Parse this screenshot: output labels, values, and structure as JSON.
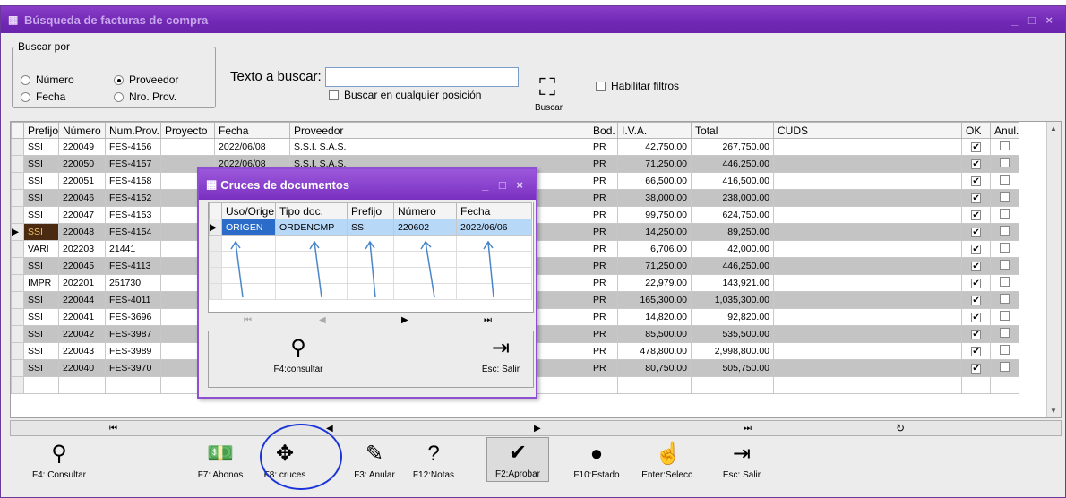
{
  "window": {
    "title": "Búsqueda de facturas de compra",
    "controls": "_ □ ×"
  },
  "search": {
    "group_label": "Buscar por",
    "radios": [
      {
        "label": "Número",
        "checked": false
      },
      {
        "label": "Proveedor",
        "checked": true
      },
      {
        "label": "Fecha",
        "checked": false
      },
      {
        "label": "Nro. Prov.",
        "checked": false
      }
    ],
    "text_label": "Texto a buscar:",
    "text_value": "",
    "anywhere_label": "Buscar en cualquier posición",
    "search_button": "Buscar",
    "filters_label": "Habilitar filtros"
  },
  "grid": {
    "columns": [
      "Prefijo",
      "Número",
      "Num.Prov.",
      "Proyecto",
      "Fecha",
      "Proveedor",
      "Bod.",
      "I.V.A.",
      "Total",
      "CUDS",
      "OK",
      "Anul."
    ],
    "rows": [
      {
        "prefijo": "SSI",
        "numero": "220049",
        "numprov": "FES-4156",
        "proyecto": "",
        "fecha": "2022/06/08",
        "proveedor": "S.S.I.  S.A.S.",
        "bod": "PR",
        "iva": "42,750.00",
        "total": "267,750.00",
        "ok": true,
        "anul": false
      },
      {
        "prefijo": "SSI",
        "numero": "220050",
        "numprov": "FES-4157",
        "proyecto": "",
        "fecha": "2022/06/08",
        "proveedor": "S.S.I.  S.A.S.",
        "bod": "PR",
        "iva": "71,250.00",
        "total": "446,250.00",
        "ok": true,
        "anul": false
      },
      {
        "prefijo": "SSI",
        "numero": "220051",
        "numprov": "FES-4158",
        "proyecto": "",
        "fecha": "",
        "proveedor": "",
        "bod": "PR",
        "iva": "66,500.00",
        "total": "416,500.00",
        "ok": true,
        "anul": false
      },
      {
        "prefijo": "SSI",
        "numero": "220046",
        "numprov": "FES-4152",
        "proyecto": "",
        "fecha": "",
        "proveedor": "",
        "bod": "PR",
        "iva": "38,000.00",
        "total": "238,000.00",
        "ok": true,
        "anul": false
      },
      {
        "prefijo": "SSI",
        "numero": "220047",
        "numprov": "FES-4153",
        "proyecto": "",
        "fecha": "",
        "proveedor": "",
        "bod": "PR",
        "iva": "99,750.00",
        "total": "624,750.00",
        "ok": true,
        "anul": false
      },
      {
        "prefijo": "SSI",
        "numero": "220048",
        "numprov": "FES-4154",
        "proyecto": "",
        "fecha": "",
        "proveedor": "",
        "bod": "PR",
        "iva": "14,250.00",
        "total": "89,250.00",
        "ok": true,
        "anul": false
      },
      {
        "prefijo": "VARI",
        "numero": "202203",
        "numprov": "21441",
        "proyecto": "",
        "fecha": "",
        "proveedor": "",
        "bod": "PR",
        "iva": "6,706.00",
        "total": "42,000.00",
        "ok": true,
        "anul": false
      },
      {
        "prefijo": "SSI",
        "numero": "220045",
        "numprov": "FES-4113",
        "proyecto": "",
        "fecha": "",
        "proveedor": "",
        "bod": "PR",
        "iva": "71,250.00",
        "total": "446,250.00",
        "ok": true,
        "anul": false
      },
      {
        "prefijo": "IMPR",
        "numero": "202201",
        "numprov": "251730",
        "proyecto": "",
        "fecha": "",
        "proveedor": "",
        "bod": "PR",
        "iva": "22,979.00",
        "total": "143,921.00",
        "ok": true,
        "anul": false
      },
      {
        "prefijo": "SSI",
        "numero": "220044",
        "numprov": "FES-4011",
        "proyecto": "",
        "fecha": "",
        "proveedor": "",
        "bod": "PR",
        "iva": "165,300.00",
        "total": "1,035,300.00",
        "ok": true,
        "anul": false
      },
      {
        "prefijo": "SSI",
        "numero": "220041",
        "numprov": "FES-3696",
        "proyecto": "",
        "fecha": "",
        "proveedor": "",
        "bod": "PR",
        "iva": "14,820.00",
        "total": "92,820.00",
        "ok": true,
        "anul": false
      },
      {
        "prefijo": "SSI",
        "numero": "220042",
        "numprov": "FES-3987",
        "proyecto": "",
        "fecha": "",
        "proveedor": "",
        "bod": "PR",
        "iva": "85,500.00",
        "total": "535,500.00",
        "ok": true,
        "anul": false
      },
      {
        "prefijo": "SSI",
        "numero": "220043",
        "numprov": "FES-3989",
        "proyecto": "",
        "fecha": "",
        "proveedor": "",
        "bod": "PR",
        "iva": "478,800.00",
        "total": "2,998,800.00",
        "ok": true,
        "anul": false
      },
      {
        "prefijo": "SSI",
        "numero": "220040",
        "numprov": "FES-3970",
        "proyecto": "",
        "fecha": "",
        "proveedor": "",
        "bod": "PR",
        "iva": "80,750.00",
        "total": "505,750.00",
        "ok": true,
        "anul": false
      }
    ],
    "selected_row": 5
  },
  "toolbar": [
    {
      "label": "F4: Consultar",
      "icon": "binoculars-icon",
      "glyph": "⚲"
    },
    {
      "label": "F7: Abonos",
      "icon": "money-icon",
      "glyph": "💵"
    },
    {
      "label": "F8: cruces",
      "icon": "cross-arrows-icon",
      "glyph": "✥"
    },
    {
      "label": "F3: Anular",
      "icon": "eraser-icon",
      "glyph": "✎"
    },
    {
      "label": "F12:Notas",
      "icon": "help-note-icon",
      "glyph": "?"
    },
    {
      "label": "F2:Aprobar",
      "icon": "approve-icon",
      "glyph": "✔"
    },
    {
      "label": "F10:Estado",
      "icon": "status-icon",
      "glyph": "●"
    },
    {
      "label": "Enter:Selecc.",
      "icon": "hand-pointer-icon",
      "glyph": "☝"
    },
    {
      "label": "Esc: Salir",
      "icon": "exit-door-icon",
      "glyph": "⇥"
    }
  ],
  "dialog": {
    "title": "Cruces de documentos",
    "controls": "_ □ ×",
    "columns": [
      "Uso/Orige",
      "Tipo doc.",
      "Prefijo",
      "Número",
      "Fecha"
    ],
    "rows": [
      {
        "uso": "ORIGEN",
        "tipo": "ORDENCMP",
        "prefijo": "SSI",
        "numero": "220602",
        "fecha": "2022/06/06"
      }
    ],
    "consultar_label": "F4:consultar",
    "salir_label": "Esc: Salir"
  }
}
